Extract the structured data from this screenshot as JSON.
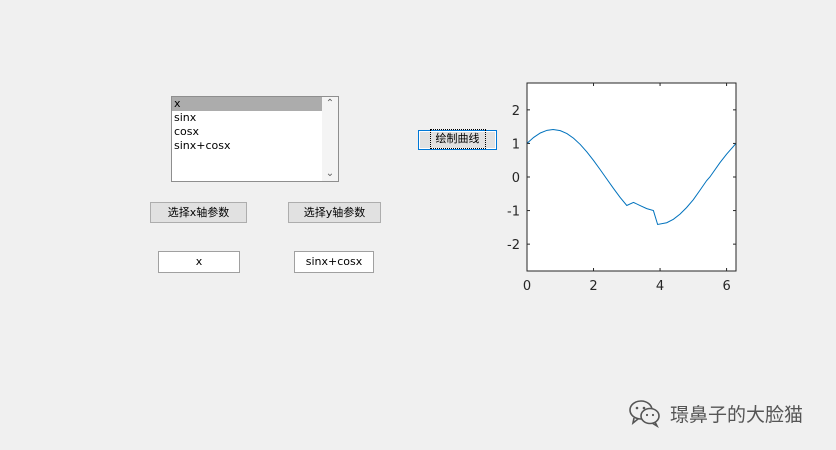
{
  "listbox": {
    "items": [
      "x",
      "sinx",
      "cosx",
      "sinx+cosx"
    ],
    "selected_index": 0
  },
  "buttons": {
    "select_x_label": "选择x轴参数",
    "select_y_label": "选择y轴参数",
    "plot_label": "绘制曲线"
  },
  "fields": {
    "x_value": "x",
    "y_value": "sinx+cosx"
  },
  "watermark": {
    "text": "璟鼻子的大脸猫",
    "icon": "wechat-icon"
  },
  "chart_data": {
    "type": "line",
    "title": "",
    "xlabel": "",
    "ylabel": "",
    "xlim": [
      0,
      6.2832
    ],
    "ylim": [
      -2.8,
      2.8
    ],
    "x_ticks": [
      0,
      2,
      4,
      6
    ],
    "y_ticks": [
      2,
      1,
      0,
      -1,
      -2
    ],
    "series": [
      {
        "color": "#0072bd",
        "x": [
          0,
          0.2,
          0.4,
          0.6,
          0.7854,
          1.0,
          1.2,
          1.4,
          1.6,
          1.8,
          2.0,
          2.2,
          2.3562,
          2.6,
          2.8,
          3.0,
          3.2,
          3.4,
          3.6,
          3.8,
          3.927,
          4.2,
          4.4,
          4.6,
          4.8,
          5.0,
          5.2,
          5.4,
          5.4978,
          5.8,
          6.0,
          6.2832
        ],
        "y": [
          1.0,
          1.1787,
          1.3105,
          1.3899,
          1.4142,
          1.3818,
          1.2944,
          1.1555,
          0.9704,
          0.7466,
          0.4932,
          0.2199,
          0.0,
          -0.3414,
          -0.6077,
          -0.8489,
          -0.7559,
          -0.8514,
          -0.9412,
          -1.0,
          -1.4142,
          -1.3627,
          -1.2599,
          -1.1049,
          -0.9088,
          -0.6753,
          -0.3951,
          -0.1087,
          0.0,
          0.4267,
          0.6809,
          1.0
        ]
      }
    ]
  }
}
